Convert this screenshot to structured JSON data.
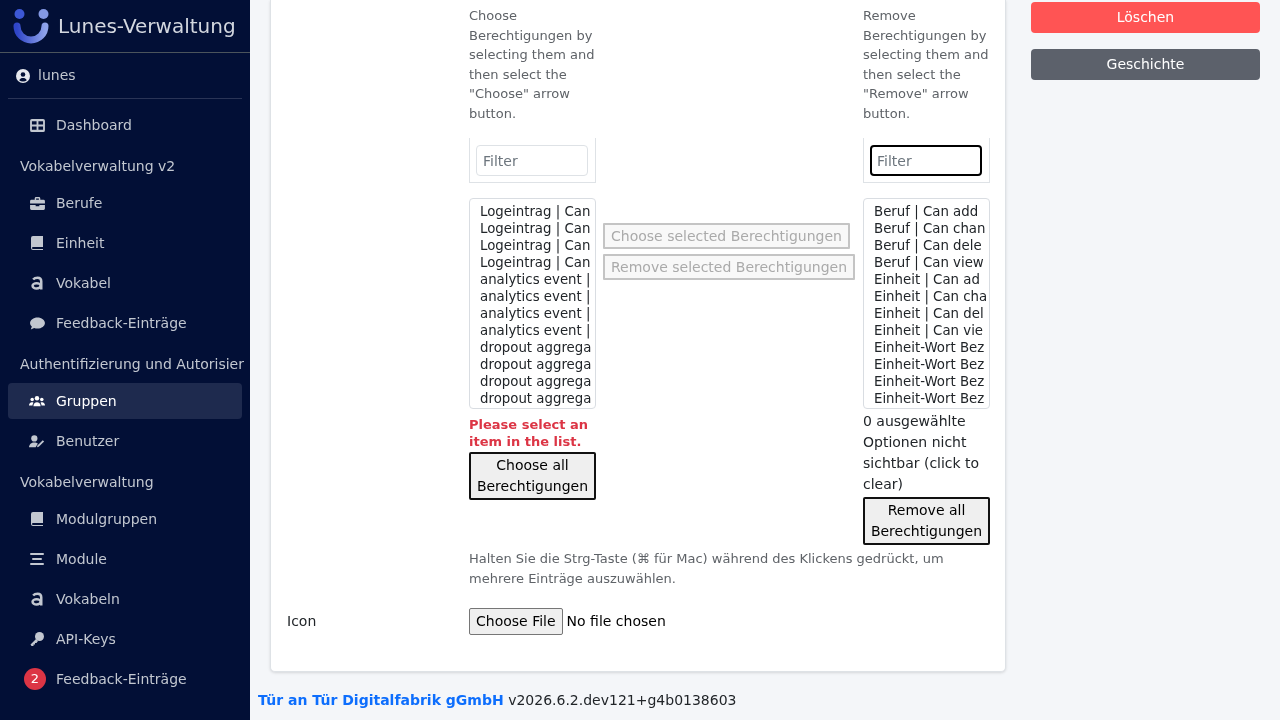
{
  "sidebar": {
    "brand": "Lunes-Verwaltung",
    "user": "lunes",
    "items": [
      {
        "kind": "link",
        "label": "Dashboard",
        "selected": false
      },
      {
        "kind": "heading",
        "label": "Vokabelverwaltung v2"
      },
      {
        "kind": "link",
        "label": "Berufe",
        "selected": false
      },
      {
        "kind": "link",
        "label": "Einheit",
        "selected": false
      },
      {
        "kind": "link",
        "label": "Vokabel",
        "selected": false
      },
      {
        "kind": "link",
        "label": "Feedback-Einträge",
        "selected": false
      },
      {
        "kind": "heading",
        "label": "Authentifizierung und Autorisier"
      },
      {
        "kind": "link",
        "label": "Gruppen",
        "selected": true
      },
      {
        "kind": "link",
        "label": "Benutzer",
        "selected": false
      },
      {
        "kind": "heading",
        "label": "Vokabelverwaltung"
      },
      {
        "kind": "link",
        "label": "Modulgruppen",
        "selected": false
      },
      {
        "kind": "link",
        "label": "Module",
        "selected": false
      },
      {
        "kind": "link",
        "label": "Vokabeln",
        "selected": false
      },
      {
        "kind": "link",
        "label": "API-Keys",
        "selected": false
      },
      {
        "kind": "link",
        "label": "Feedback-Einträge",
        "selected": false,
        "badge": "2"
      }
    ]
  },
  "form": {
    "permissions": {
      "available": {
        "help": "Choose Berechtigungen by selecting them and then select the \"Choose\" arrow button.",
        "filter": {
          "placeholder": "Filter",
          "focused": false
        },
        "options": [
          "Logeintrag | Can",
          "Logeintrag | Can",
          "Logeintrag | Can",
          "Logeintrag | Can",
          "analytics event |",
          "analytics event |",
          "analytics event |",
          "analytics event |",
          "dropout aggrega",
          "dropout aggrega",
          "dropout aggrega",
          "dropout aggrega"
        ],
        "error": "Please select an item in the list.",
        "all_button": "Choose all Berechtigungen"
      },
      "move_buttons": [
        {
          "label": "Choose selected Berechtigungen",
          "disabled": true
        },
        {
          "label": "Remove selected Berechtigungen",
          "disabled": true
        }
      ],
      "chosen": {
        "help": "Remove Berechtigungen by selecting them and then select the \"Remove\" arrow button.",
        "filter": {
          "placeholder": "Filter",
          "focused": true
        },
        "options": [
          "Beruf | Can add",
          "Beruf | Can chan",
          "Beruf | Can dele",
          "Beruf | Can view",
          "Einheit | Can ad",
          "Einheit | Can cha",
          "Einheit | Can del",
          "Einheit | Can vie",
          "Einheit-Wort Bez",
          "Einheit-Wort Bez",
          "Einheit-Wort Bez",
          "Einheit-Wort Bez"
        ],
        "hidden_note": "0 ausgewählte Optionen nicht sichtbar (click to clear)",
        "all_button": "Remove all Berechtigungen"
      },
      "help": "Halten Sie die Strg-Taste (⌘ für Mac) während des Klickens gedrückt, um mehrere Einträge auszuwählen."
    },
    "icon_field": {
      "label": "Icon",
      "button": "Choose File",
      "status": "No file chosen"
    }
  },
  "actions": [
    {
      "kind": "danger",
      "label": "Löschen"
    },
    {
      "kind": "secondary",
      "label": "Geschichte"
    }
  ],
  "footer": {
    "company": "Tür an Tür Digitalfabrik gGmbH",
    "version": "v2026.6.2.dev121+g4b0138603"
  }
}
